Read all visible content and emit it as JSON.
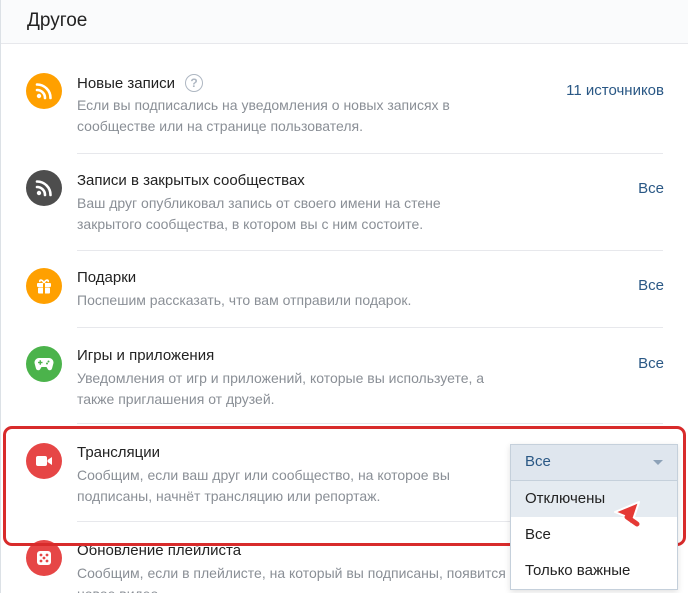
{
  "header": {
    "title": "Другое"
  },
  "items": [
    {
      "title": "Новые записи",
      "description": "Если вы подписались на уведомления о новых записях в сообществе или на странице пользователя.",
      "value": "11 источников",
      "icon": "rss-icon",
      "color": "#ffa000",
      "has_help": true
    },
    {
      "title": "Записи в закрытых сообществах",
      "description": "Ваш друг опубликовал запись от своего имени на стене закрытого сообщества, в котором вы с ним состоите.",
      "value": "Все",
      "icon": "rss-icon",
      "color": "#4d4d4d"
    },
    {
      "title": "Подарки",
      "description": "Поспешим рассказать, что вам отправили подарок.",
      "value": "Все",
      "icon": "gift-icon",
      "color": "#ffa000"
    },
    {
      "title": "Игры и приложения",
      "description": "Уведомления от игр и приложений, которые вы используете, а также приглашения от друзей.",
      "value": "Все",
      "icon": "gamepad-icon",
      "color": "#4bb34b"
    },
    {
      "title": "Трансляции",
      "description": "Сообщим, если ваш друг или сообщество, на которое вы подписаны, начнёт трансляцию или репортаж.",
      "value": "Все",
      "icon": "video-camera-icon",
      "color": "#e64646"
    },
    {
      "title": "Обновление плейлиста",
      "description": "Сообщим, если в плейлисте, на который вы подписаны, появится новое видео.",
      "icon": "dice-icon",
      "color": "#e64646"
    }
  ],
  "dropdown": {
    "selected": "Все",
    "options": [
      "Отключены",
      "Все",
      "Только важные"
    ],
    "hovered_index": 0
  },
  "colors": {
    "accent": "#2a5885",
    "highlight_frame": "#d82b2b"
  }
}
